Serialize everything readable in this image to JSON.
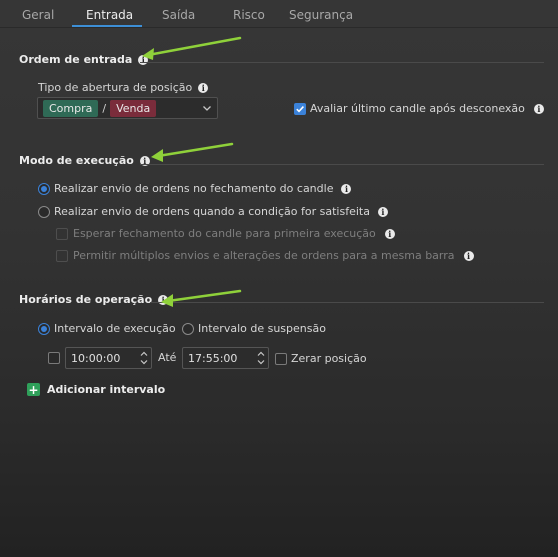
{
  "tabs": [
    {
      "label": "Geral"
    },
    {
      "label": "Entrada",
      "active": true
    },
    {
      "label": "Saída"
    },
    {
      "label": "Risco"
    },
    {
      "label": "Segurança"
    }
  ],
  "entry_order": {
    "title": "Ordem de entrada",
    "position_type_label": "Tipo de abertura de posição",
    "chip_buy": "Compra",
    "chip_separator": "/",
    "chip_sell": "Venda",
    "evaluate_last_candle": {
      "label": "Avaliar último candle após desconexão",
      "checked": true
    }
  },
  "execution_mode": {
    "title": "Modo de execução",
    "options": [
      {
        "label": "Realizar envio de ordens no fechamento do candle",
        "checked": true
      },
      {
        "label": "Realizar envio de ordens quando a condição for satisfeita",
        "checked": false
      }
    ],
    "sub_options": [
      {
        "label": "Esperar fechamento do candle para primeira execução",
        "checked": false,
        "disabled": true
      },
      {
        "label": "Permitir múltiplos envios e alterações de ordens para a mesma barra",
        "checked": false,
        "disabled": true
      }
    ]
  },
  "operating_hours": {
    "title": "Horários de operação",
    "interval_execution": {
      "label": "Intervalo de execução",
      "checked": true
    },
    "interval_suspension": {
      "label": "Intervalo de suspensão",
      "checked": false
    },
    "start_time": "10:00:00",
    "until_label": "Até",
    "end_time": "17:55:00",
    "reset_position": {
      "label": "Zerar posição",
      "checked": false
    },
    "add_interval_label": "Adicionar intervalo",
    "add_icon_glyph": "+"
  },
  "info_glyph": "i",
  "colors": {
    "accent": "#3b82d9",
    "buy": "#2f6a56",
    "sell": "#7a2c3b",
    "add": "#2fa05a",
    "arrow": "#8fd13a"
  }
}
